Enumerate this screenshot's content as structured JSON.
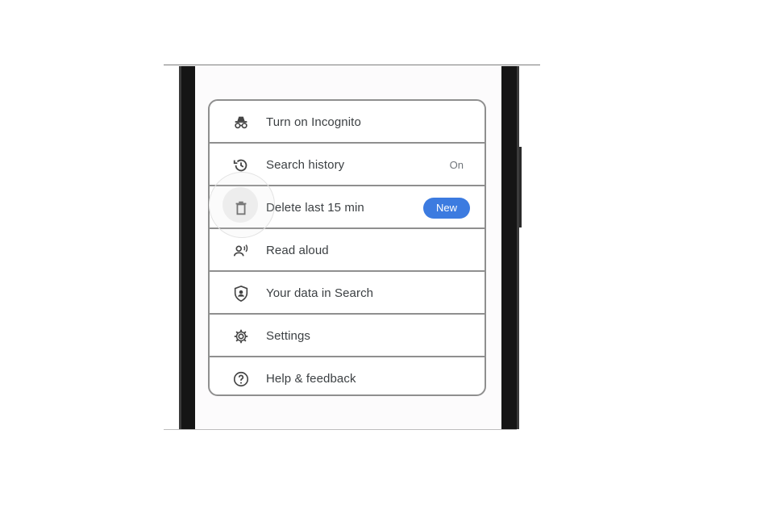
{
  "menu": {
    "items": [
      {
        "label": "Turn on Incognito",
        "icon": "incognito-icon"
      },
      {
        "label": "Search history",
        "icon": "history-icon",
        "status": "On"
      },
      {
        "label": "Delete last 15 min",
        "icon": "trash-icon",
        "badge": "New"
      },
      {
        "label": "Read aloud",
        "icon": "read-aloud-icon"
      },
      {
        "label": "Your data in Search",
        "icon": "shield-user-icon"
      },
      {
        "label": "Settings",
        "icon": "gear-icon"
      },
      {
        "label": "Help & feedback",
        "icon": "help-icon"
      }
    ]
  },
  "colors": {
    "badge": "#3c7be0",
    "text": "#3c4043",
    "border": "#8f8f8f"
  }
}
